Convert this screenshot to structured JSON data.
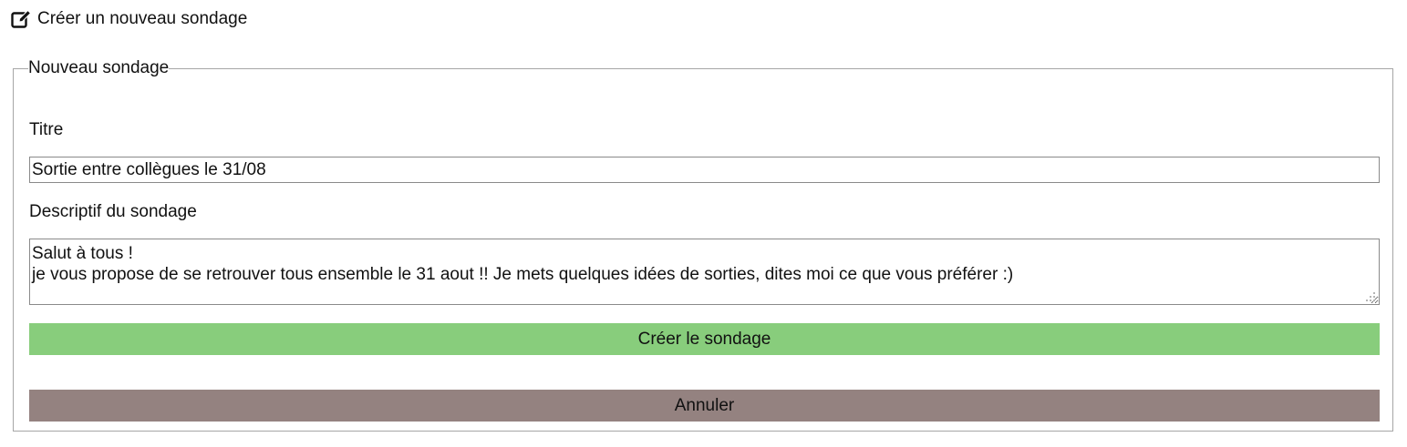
{
  "header": {
    "icon": "edit-icon",
    "title": "Créer un nouveau sondage"
  },
  "form": {
    "legend": "Nouveau sondage",
    "title_label": "Titre",
    "title_value": "Sortie entre collègues le 31/08",
    "description_label": "Descriptif du sondage",
    "description_value": "Salut à tous !\nje vous propose de se retrouver tous ensemble le 31 aout !! Je mets quelques idées de sorties, dites moi ce que vous préférer :)",
    "create_button": "Créer le sondage",
    "cancel_button": "Annuler"
  },
  "colors": {
    "create_button_bg": "#88cd7c",
    "cancel_button_bg": "#948280",
    "border": "#a6a6a6"
  }
}
